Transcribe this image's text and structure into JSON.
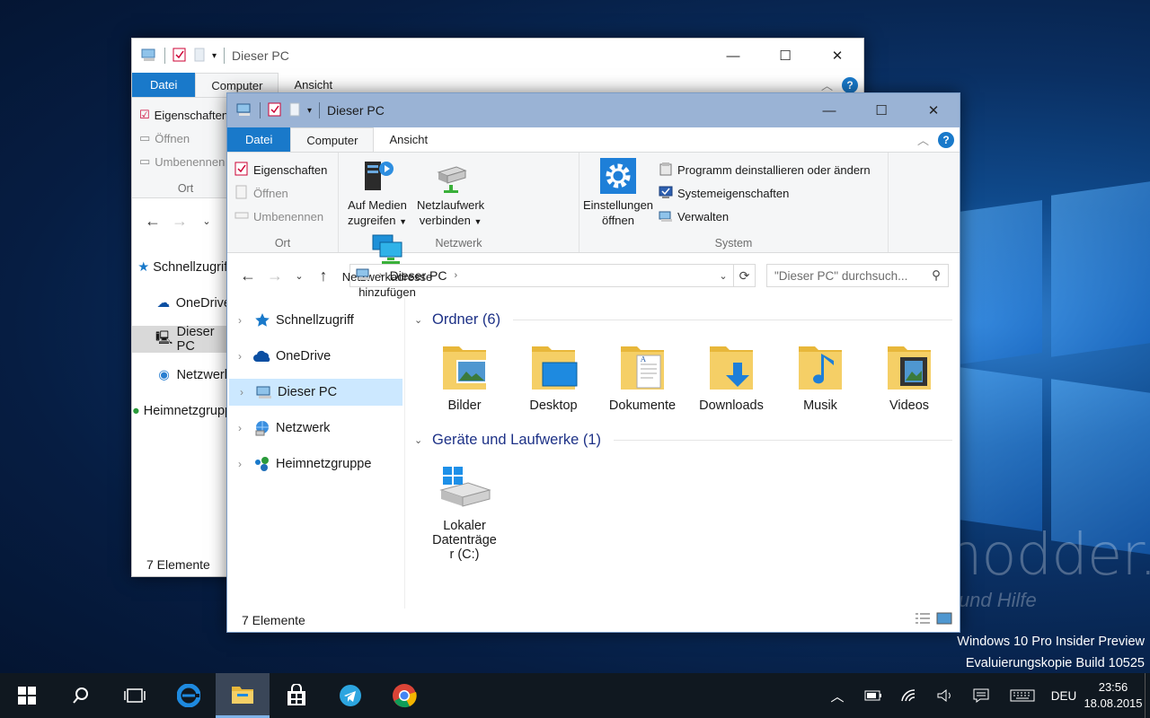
{
  "desktop": {
    "watermark_line1": "Windows 10 Pro Insider Preview",
    "watermark_line2": "Evaluierungskopie Build 10525",
    "site_logo": "Deskmodder.de",
    "site_tagline": "News, Tipps und Hilfe"
  },
  "back_window": {
    "title": "Dieser PC",
    "tabs": [
      "Datei",
      "Computer",
      "Ansicht"
    ],
    "ribbon": {
      "prop": "Eigenschaften",
      "open": "Öffnen",
      "rename": "Umbenennen",
      "group": "Ort"
    },
    "nav": [
      "Schnellzugriff",
      "OneDrive",
      "Dieser PC",
      "Netzwerk",
      "Heimnetzgruppe"
    ],
    "status": "7 Elemente"
  },
  "window": {
    "title": "Dieser PC",
    "tabs": {
      "file": "Datei",
      "computer": "Computer",
      "view": "Ansicht"
    },
    "ribbon": {
      "ort": {
        "properties": "Eigenschaften",
        "open": "Öffnen",
        "rename": "Umbenennen",
        "label": "Ort"
      },
      "netzwerk": {
        "media_l1": "Auf Medien",
        "media_l2": "zugreifen",
        "drive_l1": "Netzlaufwerk",
        "drive_l2": "verbinden",
        "addr_l1": "Netzwerkadresse",
        "addr_l2": "hinzufügen",
        "label": "Netzwerk"
      },
      "system": {
        "settings_l1": "Einstellungen",
        "settings_l2": "öffnen",
        "uninstall": "Programm deinstallieren oder ändern",
        "sysprops": "Systemeigenschaften",
        "manage": "Verwalten",
        "label": "System"
      }
    },
    "address": {
      "path": "Dieser PC",
      "search_placeholder": "\"Dieser PC\" durchsuch..."
    },
    "nav": {
      "quick": "Schnellzugriff",
      "onedrive": "OneDrive",
      "thispc": "Dieser PC",
      "network": "Netzwerk",
      "homegroup": "Heimnetzgruppe"
    },
    "sections": {
      "folders": "Ordner (6)",
      "drives": "Geräte und Laufwerke (1)"
    },
    "folders": {
      "pictures": "Bilder",
      "desktop": "Desktop",
      "documents": "Dokumente",
      "downloads": "Downloads",
      "music": "Musik",
      "videos": "Videos"
    },
    "drive": {
      "l1": "Lokaler",
      "l2": "Datenträge",
      "l3": "r (C:)"
    },
    "status": "7 Elemente"
  },
  "taskbar": {
    "language": "DEU",
    "time": "23:56",
    "date": "18.08.2015"
  },
  "colors": {
    "accent": "#1979ca",
    "selection": "#cce8ff",
    "section_heading": "#1e3287"
  }
}
